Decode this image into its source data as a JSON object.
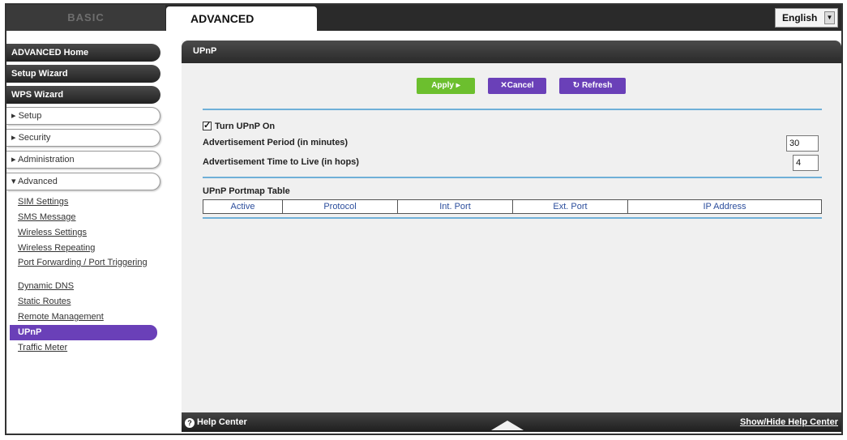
{
  "tabs": {
    "basic": "BASIC",
    "advanced": "ADVANCED"
  },
  "language": {
    "selected": "English"
  },
  "sidebar": {
    "main_items": [
      "ADVANCED Home",
      "Setup Wizard",
      "WPS Wizard"
    ],
    "sections": [
      "▸ Setup",
      "▸ Security",
      "▸ Administration",
      "▾ Advanced"
    ],
    "sub_items": [
      "SIM Settings",
      "SMS Message",
      "Wireless Settings",
      "Wireless Repeating",
      "Port Forwarding / Port Triggering",
      "Dynamic DNS",
      "Static Routes",
      "Remote Management",
      "UPnP",
      "Traffic Meter"
    ],
    "active": "UPnP"
  },
  "panel": {
    "title": "UPnP"
  },
  "buttons": {
    "apply": "Apply ▸",
    "cancel": "✕Cancel",
    "refresh": "↻ Refresh"
  },
  "upnp": {
    "turn_on_label": "Turn UPnP On",
    "turn_on_checked": true,
    "adv_period_label": "Advertisement Period (in minutes)",
    "adv_period_value": "30",
    "adv_ttl_label": "Advertisement Time to Live (in hops)",
    "adv_ttl_value": "4"
  },
  "portmap": {
    "title": "UPnP Portmap Table",
    "columns": [
      "Active",
      "Protocol",
      "Int. Port",
      "Ext. Port",
      "IP Address"
    ]
  },
  "help": {
    "left": "Help Center",
    "right": "Show/Hide Help Center"
  }
}
